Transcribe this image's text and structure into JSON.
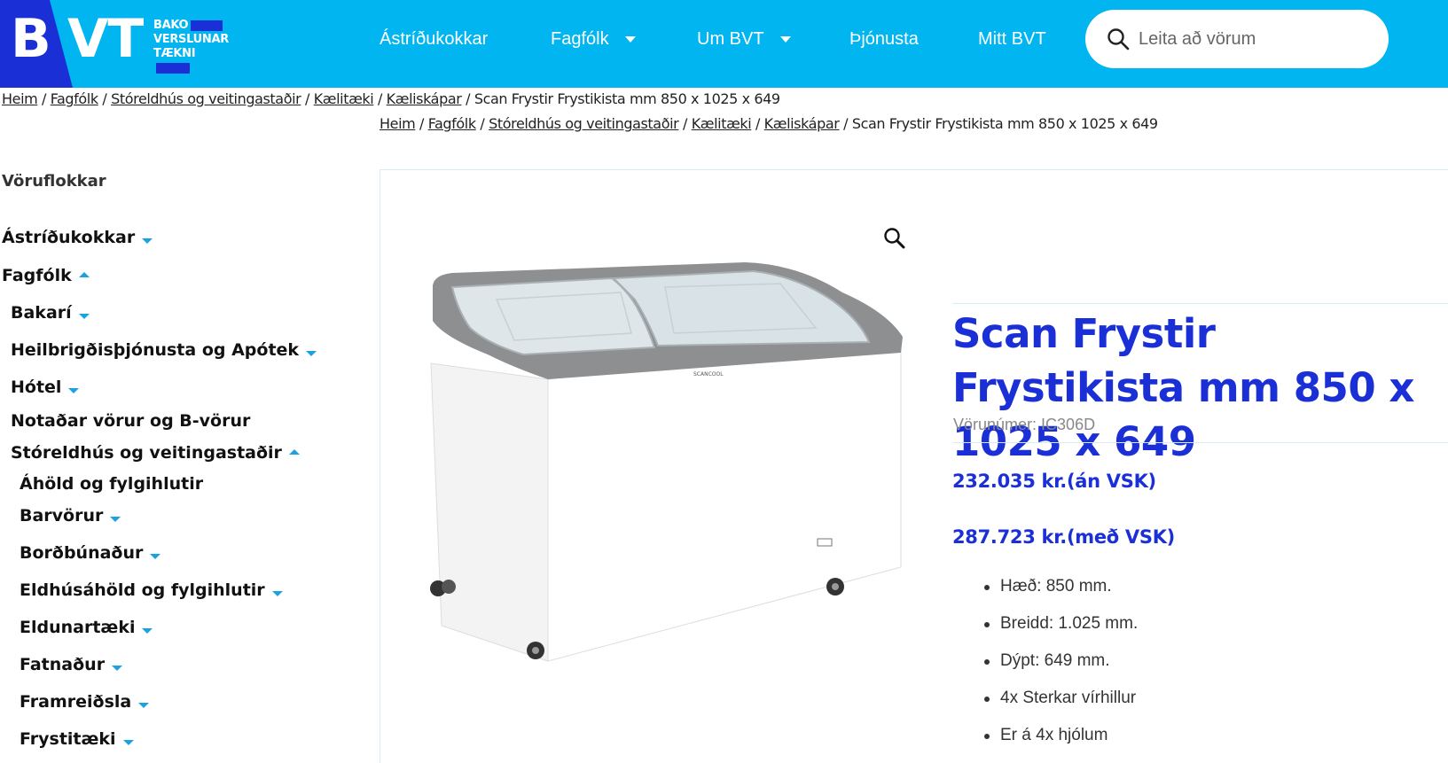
{
  "header": {
    "logo_letter": "B",
    "logo_letters": "VT",
    "logo_sub": [
      "BAKO",
      "VERSLUNAR",
      "TÆKNI"
    ],
    "nav": [
      {
        "label": "Ástríðukokkar",
        "has_dropdown": false
      },
      {
        "label": "Fagfólk",
        "has_dropdown": true
      },
      {
        "label": "Um BVT",
        "has_dropdown": true
      },
      {
        "label": "Þjónusta",
        "has_dropdown": false
      },
      {
        "label": "Mitt BVT",
        "has_dropdown": false
      }
    ],
    "search_placeholder": "Leita að vörum"
  },
  "breadcrumb": {
    "links": [
      "Heim",
      "Fagfólk",
      "Stóreldhús og veitingastaðir",
      "Kælitæki",
      "Kæliskápar"
    ],
    "current": "Scan Frystir Frystikista mm 850 x 1025 x 649",
    "separator": " / "
  },
  "sidebar": {
    "title": "Vöruflokkar",
    "categories": [
      {
        "label": "Ástríðukokkar",
        "arrow": "down",
        "level": 0
      },
      {
        "label": "Fagfólk",
        "arrow": "up",
        "level": 0
      },
      {
        "label": "Bakarí",
        "arrow": "down",
        "level": 1
      },
      {
        "label": "Heilbrigðisþjónusta og Apótek",
        "arrow": "down",
        "level": 1
      },
      {
        "label": "Hótel",
        "arrow": "down",
        "level": 1
      },
      {
        "label": "Notaðar vörur og B-vörur",
        "arrow": "none",
        "level": 1
      },
      {
        "label": "Stóreldhús og veitingastaðir",
        "arrow": "up",
        "level": 1
      },
      {
        "label": "Áhöld og fylgihlutir",
        "arrow": "none",
        "level": 2
      },
      {
        "label": "Barvörur",
        "arrow": "down",
        "level": 2
      },
      {
        "label": "Borðbúnaður",
        "arrow": "down",
        "level": 2
      },
      {
        "label": "Eldhúsáhöld og fylgihlutir",
        "arrow": "down",
        "level": 2
      },
      {
        "label": "Eldunartæki",
        "arrow": "down",
        "level": 2
      },
      {
        "label": "Fatnaður",
        "arrow": "down",
        "level": 2
      },
      {
        "label": "Framreiðsla",
        "arrow": "down",
        "level": 2
      },
      {
        "label": "Frystitæki",
        "arrow": "down",
        "level": 2
      }
    ]
  },
  "product": {
    "title": "Scan Frystir Frystikista mm 850 x 1025 x 649",
    "sku_label": "Vörunúmer: IC306D",
    "price_ex_vat": "232.035 kr.(án VSK)",
    "price_inc_vat": "287.723 kr.(með VSK)",
    "brand_on_image": "SCANCOOL",
    "specs": [
      "Hæð: 850 mm.",
      "Breidd: 1.025 mm.",
      "Dýpt: 649 mm.",
      "4x Sterkar vírhillur",
      "Er á 4x hjólum"
    ]
  },
  "colors": {
    "header_bg": "#00b5f0",
    "brand_blue": "#1a30d6",
    "accent_arrow": "#1aa3e0"
  }
}
